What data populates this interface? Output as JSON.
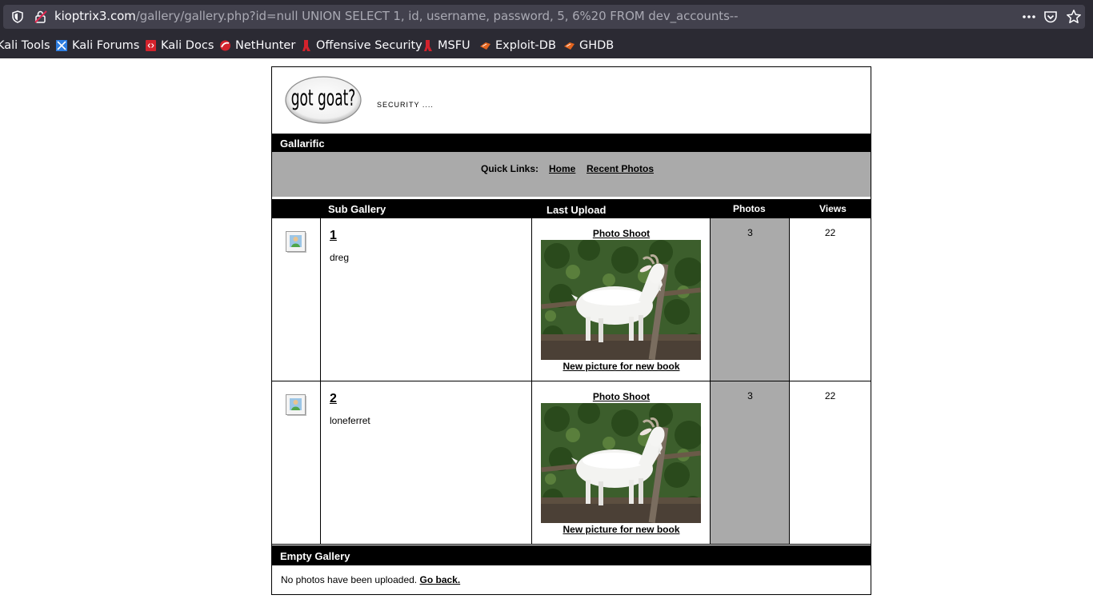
{
  "browser": {
    "url_host": "kioptrix3.com",
    "url_rest": "/gallery/gallery.php?id=null UNION SELECT 1, id, username, password, 5, 6%20 FROM dev_accounts--",
    "icons": [
      "shield-icon",
      "insecure-lock-icon",
      "page-actions-icon",
      "pocket-icon",
      "bookmark-star-icon"
    ],
    "bookmarks": [
      {
        "label": "Kali Tools",
        "icon": "kali-tools-icon"
      },
      {
        "label": "Kali Forums",
        "icon": "kali-forums-icon"
      },
      {
        "label": "Kali Docs",
        "icon": "kali-docs-icon"
      },
      {
        "label": "NetHunter",
        "icon": "nethunter-icon"
      },
      {
        "label": "Offensive Security",
        "icon": "offsec-icon"
      },
      {
        "label": "MSFU",
        "icon": "msfu-icon"
      },
      {
        "label": "Exploit-DB",
        "icon": "exploitdb-icon"
      },
      {
        "label": "GHDB",
        "icon": "ghdb-icon"
      }
    ]
  },
  "header": {
    "logo_text": "got goat?",
    "tagline": "SECURITY ...."
  },
  "gallarific": {
    "title": "Gallarific",
    "quick_links_label": "Quick Links:",
    "links": [
      "Home",
      "Recent Photos"
    ]
  },
  "table": {
    "columns": [
      "Sub Gallery",
      "Last Upload",
      "Photos",
      "Views"
    ],
    "rows": [
      {
        "number": "1",
        "owner": "dreg",
        "last_upload_title": "Photo Shoot",
        "last_upload_caption": "New picture for new book",
        "photos": "3",
        "views": "22"
      },
      {
        "number": "2",
        "owner": "loneferret",
        "last_upload_title": "Photo Shoot",
        "last_upload_caption": "New picture for new book",
        "photos": "3",
        "views": "22"
      }
    ]
  },
  "empty_gallery": {
    "title": "Empty Gallery",
    "message": "No photos have been uploaded.",
    "go_back": "Go back."
  },
  "colors": {
    "chrome_bg": "#2b2a33",
    "urlbar_bg": "#42414d",
    "gray_cell": "#aaaaaa",
    "bar_black": "#000000"
  }
}
